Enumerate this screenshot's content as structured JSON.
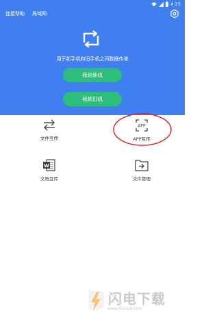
{
  "status_bar": {
    "time": "4:25",
    "icons": [
      "wifi-icon",
      "signal-icon",
      "battery-icon"
    ]
  },
  "header": {
    "links": [
      "连接帮助",
      "局域网"
    ],
    "settings_icon": "gear-icon",
    "accent_color": "#3f7ff0"
  },
  "hero": {
    "icon": "transfer-arrows-icon",
    "tagline": "用于新手机和旧手机之间数据传递",
    "new_phone_button": "我是新机",
    "old_phone_button": "我是旧机",
    "button_color": "#2bbf7a"
  },
  "features": [
    {
      "label": "文件互传",
      "icon": "swap-arrows-icon"
    },
    {
      "label": "APP互传",
      "icon": "app-icon",
      "badge_text": "APP"
    },
    {
      "label": "文档互传",
      "icon": "word-document-icon",
      "badge_text": "W"
    },
    {
      "label": "文件管理",
      "icon": "folder-arrow-icon"
    }
  ],
  "watermark": {
    "title": "闪电下载",
    "url": "www.dianlut.com"
  }
}
